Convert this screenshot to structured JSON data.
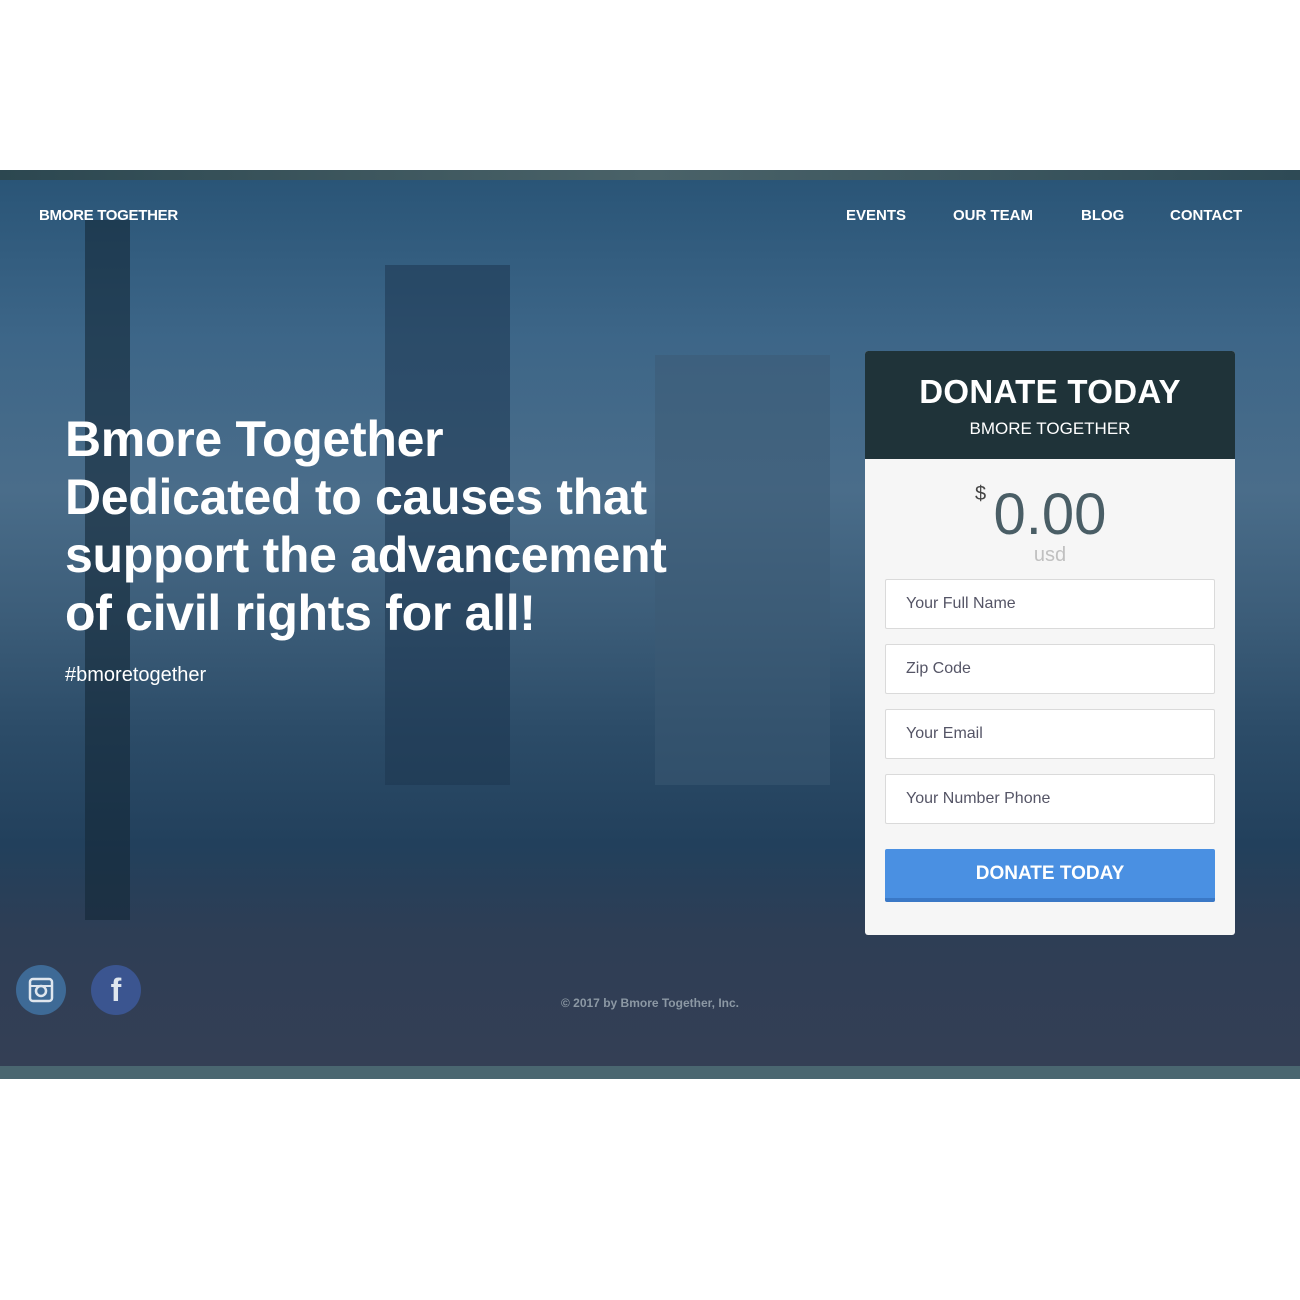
{
  "header": {
    "brand": "BMORE TOGETHER",
    "nav": [
      "EVENTS",
      "OUR TEAM",
      "BLOG",
      "CONTACT"
    ]
  },
  "hero": {
    "headline_lines": [
      "Bmore Together",
      "Dedicated to causes that",
      "support the advancement",
      "of civil rights for all!"
    ],
    "hashtag": "#bmoretogether"
  },
  "donate": {
    "title": "DONATE TODAY",
    "subtitle": "BMORE TOGETHER",
    "currency_symbol": "$",
    "amount": "0.00",
    "currency": "usd",
    "fields": [
      {
        "placeholder": "Your Full Name",
        "value": ""
      },
      {
        "placeholder": "Zip Code",
        "value": ""
      },
      {
        "placeholder": "Your Email",
        "value": ""
      },
      {
        "placeholder": "Your Number Phone",
        "value": ""
      }
    ],
    "button": "DONATE TODAY",
    "accent": "#4a90e2",
    "header_color": "#1f3339"
  },
  "footer": {
    "social": [
      "instagram-icon",
      "facebook-icon"
    ],
    "copyright": "© 2017 by Bmore Together, Inc."
  }
}
